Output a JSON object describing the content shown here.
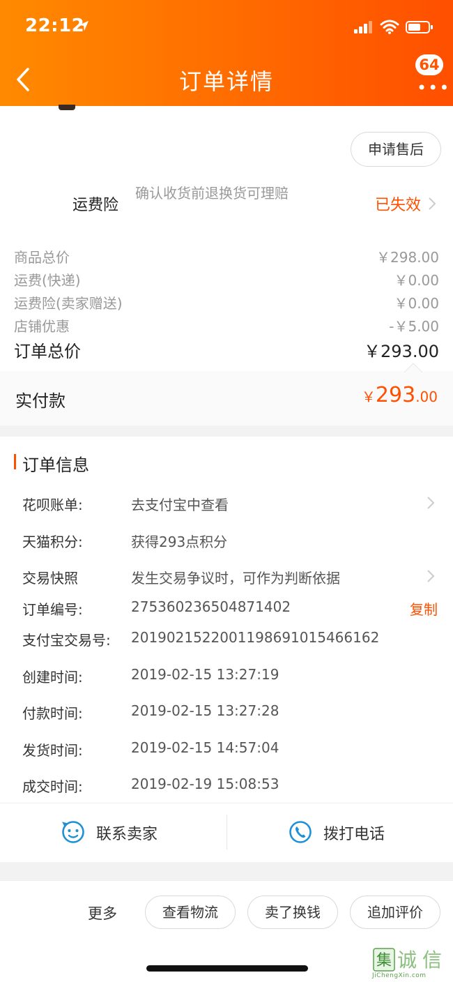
{
  "status_bar": {
    "time": "22:12"
  },
  "header": {
    "title": "订单详情",
    "badge": "64"
  },
  "after_sale_button": "申请售后",
  "freight_insurance": {
    "label": "运费险",
    "description": "确认收货前退换货可理赔",
    "status": "已失效"
  },
  "price_breakdown": [
    {
      "label": "商品总价",
      "value": "￥298.00"
    },
    {
      "label": "运费(快递)",
      "value": "￥0.00"
    },
    {
      "label": "运费险(卖家赠送)",
      "value": "￥0.00"
    },
    {
      "label": "店铺优惠",
      "value": "-￥5.00"
    }
  ],
  "order_total": {
    "label": "订单总价",
    "value": "￥293.00"
  },
  "paid": {
    "label": "实付款",
    "symbol": "￥",
    "integer": "293",
    "decimal": ".00"
  },
  "order_info": {
    "title": "订单信息",
    "rows": [
      {
        "label": "花呗账单:",
        "value": "去支付宝中查看"
      },
      {
        "label": "天猫积分:",
        "value": "获得293点积分"
      },
      {
        "label": "交易快照",
        "value": "发生交易争议时，可作为判断依据"
      },
      {
        "label": "订单编号:",
        "value": "275360236504871402",
        "action": "复制"
      },
      {
        "label": "支付宝交易号:",
        "value": "2019021522001198691015466162"
      },
      {
        "label": "创建时间:",
        "value": "2019-02-15 13:27:19"
      },
      {
        "label": "付款时间:",
        "value": "2019-02-15 13:27:28"
      },
      {
        "label": "发货时间:",
        "value": "2019-02-15 14:57:04"
      },
      {
        "label": "成交时间:",
        "value": "2019-02-19 15:08:53"
      }
    ]
  },
  "contact": {
    "seller": "联系卖家",
    "call": "拨打电话"
  },
  "bottom_actions": {
    "more": "更多",
    "logistics": "查看物流",
    "resell": "卖了换钱",
    "review": "追加评价"
  },
  "watermark": {
    "chars": "集诚信",
    "url": "JiChengXin.com"
  },
  "colors": {
    "accent": "#ff5000",
    "header_start": "#ff8a00",
    "header_end": "#ff4f00",
    "icon_blue": "#1e90d6"
  }
}
